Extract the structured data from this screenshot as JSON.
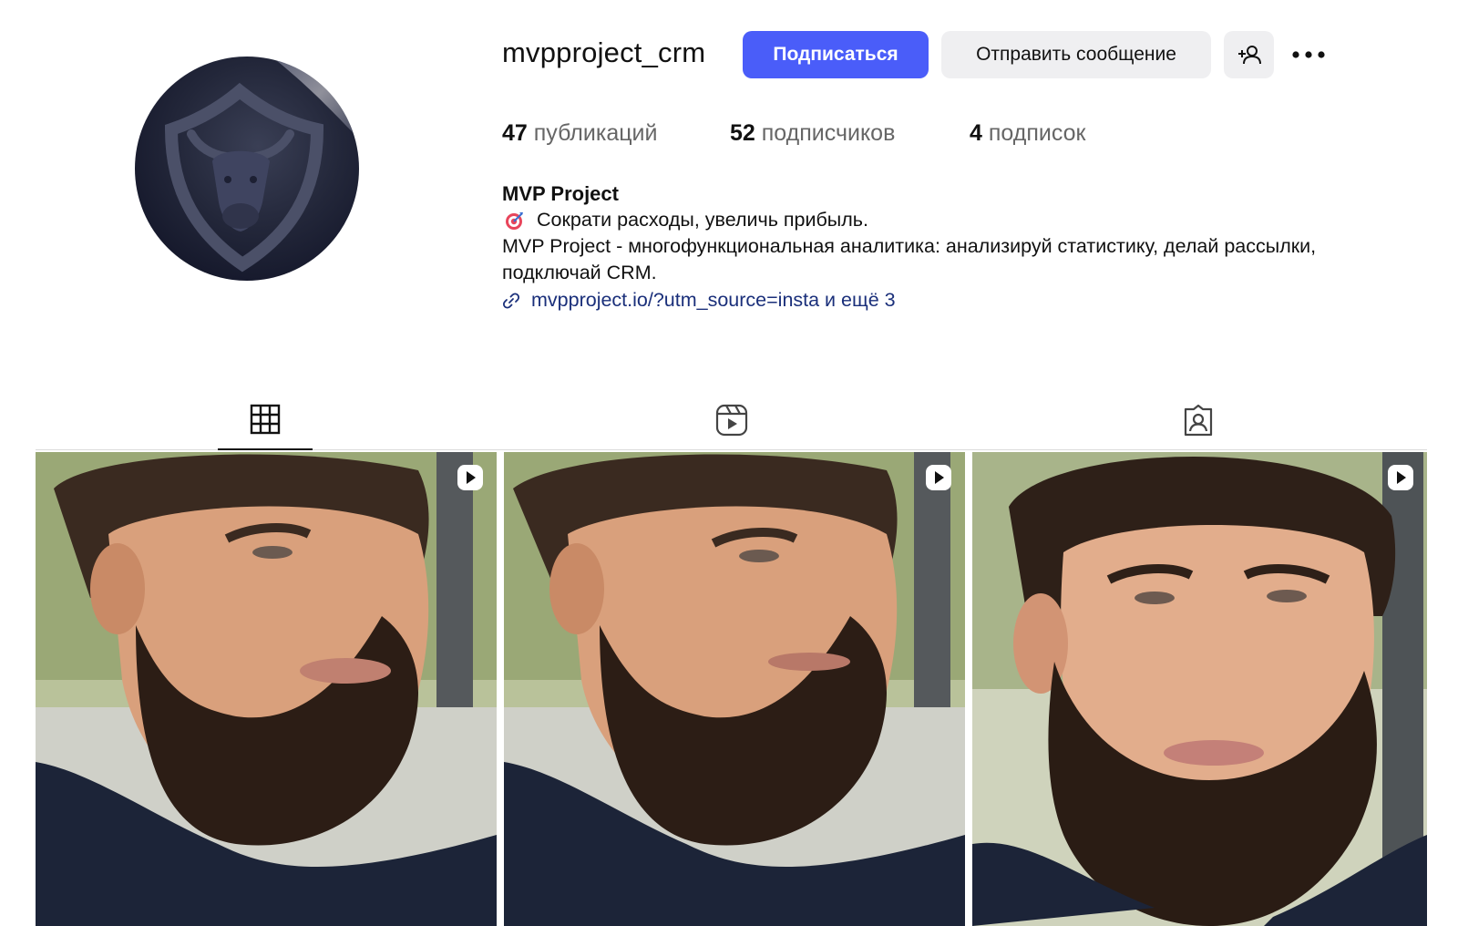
{
  "profile": {
    "username": "mvpproject_crm",
    "follow_label": "Подписаться",
    "message_label": "Отправить сообщение",
    "add_user_icon": "person-plus-icon",
    "more_icon": "more-horizontal-icon"
  },
  "stats": {
    "posts_count": "47",
    "posts_label": "публикаций",
    "followers_count": "52",
    "followers_label": "подписчиков",
    "following_count": "4",
    "following_label": "подписок"
  },
  "bio": {
    "name": "MVP Project",
    "line1_emoji": "target-icon",
    "line1": "Сократи расходы, увеличь прибыль.",
    "line2": "MVP Project - многофункциональная аналитика: анализируй статистику, делай рассылки, подключай CRM.",
    "link_icon": "link-icon",
    "link_text": "mvpproject.io/?utm_source=insta и ещё 3"
  },
  "tabs": [
    {
      "name": "posts",
      "icon": "grid-icon",
      "active": true
    },
    {
      "name": "reels",
      "icon": "reels-icon",
      "active": false
    },
    {
      "name": "tagged",
      "icon": "tagged-icon",
      "active": false
    }
  ],
  "posts": [
    {
      "type": "reel",
      "icon": "reel-play-icon"
    },
    {
      "type": "reel",
      "icon": "reel-play-icon"
    },
    {
      "type": "reel",
      "icon": "reel-play-icon"
    }
  ],
  "colors": {
    "accent": "#4a5df9",
    "link": "#1a2f7a",
    "secondary_button": "#efeff1"
  }
}
